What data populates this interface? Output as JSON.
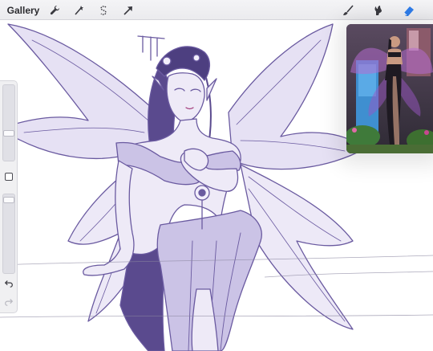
{
  "toolbar": {
    "gallery_label": "Gallery",
    "actions": [
      {
        "name": "wrench-icon"
      },
      {
        "name": "adjustments-wand-icon"
      },
      {
        "name": "selection-s-icon"
      },
      {
        "name": "transform-arrow-icon"
      }
    ],
    "tools": [
      {
        "name": "brush-icon"
      },
      {
        "name": "smudge-icon"
      },
      {
        "name": "eraser-icon",
        "active": true
      }
    ]
  },
  "sidebar": {
    "brush_size": 0.55,
    "brush_opacity": 0.85,
    "icons": [
      "modify-square-icon",
      "undo-icon",
      "redo-icon"
    ]
  },
  "reference": {
    "visible": true,
    "type": "photo reference"
  },
  "colors": {
    "line_art": "#6a5aa0",
    "fill": "#cbc3e6",
    "active_tool": "#2e7ce9",
    "toolbar_bg": "#efeff2"
  }
}
